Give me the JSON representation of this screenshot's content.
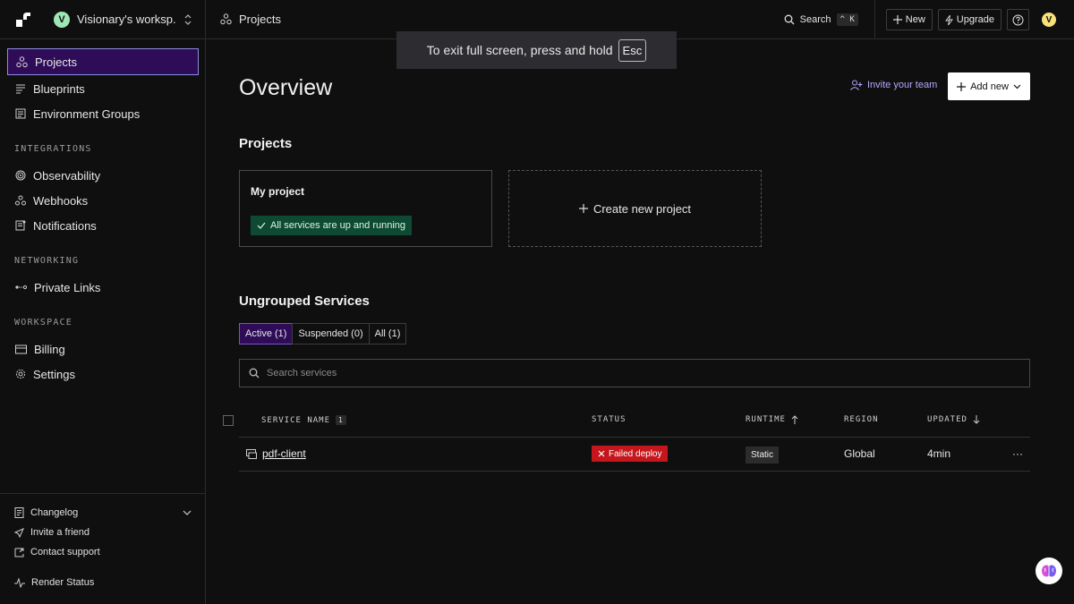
{
  "topbar": {
    "workspace_initial": "V",
    "workspace_name": "Visionary's worksp...",
    "breadcrumb": "Projects",
    "search_label": "Search",
    "search_kbd_1": "^",
    "search_kbd_2": "K",
    "new_label": "New",
    "upgrade_label": "Upgrade",
    "user_initial": "V"
  },
  "toast": {
    "text": "To exit full screen, press and hold",
    "key": "Esc"
  },
  "sidebar": {
    "items": [
      {
        "label": "Projects",
        "icon": "projects-icon",
        "active": true
      },
      {
        "label": "Blueprints",
        "icon": "blueprints-icon"
      },
      {
        "label": "Environment Groups",
        "icon": "environment-groups-icon"
      }
    ],
    "sections": [
      {
        "title": "INTEGRATIONS",
        "items": [
          {
            "label": "Observability",
            "icon": "observability-icon"
          },
          {
            "label": "Webhooks",
            "icon": "webhooks-icon"
          },
          {
            "label": "Notifications",
            "icon": "notifications-icon"
          }
        ]
      },
      {
        "title": "NETWORKING",
        "items": [
          {
            "label": "Private Links",
            "icon": "private-links-icon"
          }
        ]
      },
      {
        "title": "WORKSPACE",
        "items": [
          {
            "label": "Billing",
            "icon": "billing-icon"
          },
          {
            "label": "Settings",
            "icon": "settings-icon"
          }
        ]
      }
    ],
    "bottom": {
      "changelog": "Changelog",
      "invite_friend": "Invite a friend",
      "contact_support": "Contact support",
      "render_status": "Render Status"
    }
  },
  "main": {
    "title": "Overview",
    "invite_label": "Invite your team",
    "add_new_label": "Add new",
    "projects_heading": "Projects",
    "project": {
      "name": "My project",
      "status": "All services are up and running"
    },
    "create_project_label": "Create new project",
    "ungrouped_heading": "Ungrouped Services",
    "tabs": [
      {
        "label": "Active (1)",
        "active": true
      },
      {
        "label": "Suspended (0)"
      },
      {
        "label": "All (1)"
      }
    ],
    "search_placeholder": "Search services",
    "table": {
      "headers": {
        "service_name": "SERVICE NAME",
        "service_count": "1",
        "status": "STATUS",
        "runtime": "RUNTIME",
        "region": "REGION",
        "updated": "UPDATED"
      },
      "rows": [
        {
          "service": "pdf-client",
          "status": "Failed deploy",
          "runtime": "Static",
          "region": "Global",
          "updated": "4min",
          "more": "···"
        }
      ]
    }
  },
  "colors": {
    "active_nav_bg": "#2e0c57",
    "active_nav_border": "#8a8de0",
    "status_ok_bg": "#0e4a33",
    "failed_bg": "#c4161c",
    "invite_color": "#b9a6ff"
  }
}
